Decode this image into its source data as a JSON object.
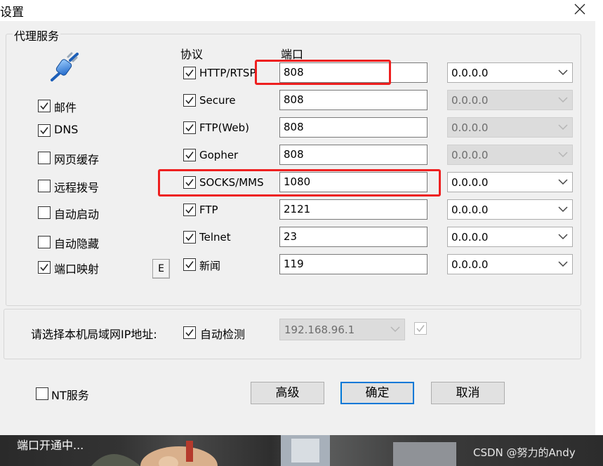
{
  "window": {
    "title": "设置"
  },
  "proxy_group": {
    "title": "代理服务",
    "services": [
      {
        "label": "邮件",
        "checked": true
      },
      {
        "label": "DNS",
        "checked": true
      },
      {
        "label": "网页缓存",
        "checked": false
      },
      {
        "label": "远程拨号",
        "checked": false
      },
      {
        "label": "自动启动",
        "checked": false
      },
      {
        "label": "自动隐藏",
        "checked": false
      },
      {
        "label": "端口映射",
        "checked": true
      }
    ],
    "port_map_button": "E",
    "protocol_header": "协议",
    "port_header": "端口",
    "protocols": [
      {
        "label": "HTTP/RTSP",
        "checked": true,
        "port": "808",
        "ip": "0.0.0.0",
        "ip_enabled": true
      },
      {
        "label": "Secure",
        "checked": true,
        "port": "808",
        "ip": "0.0.0.0",
        "ip_enabled": false
      },
      {
        "label": "FTP(Web)",
        "checked": true,
        "port": "808",
        "ip": "0.0.0.0",
        "ip_enabled": false
      },
      {
        "label": "Gopher",
        "checked": true,
        "port": "808",
        "ip": "0.0.0.0",
        "ip_enabled": false
      },
      {
        "label": "SOCKS/MMS",
        "checked": true,
        "port": "1080",
        "ip": "0.0.0.0",
        "ip_enabled": true
      },
      {
        "label": "FTP",
        "checked": true,
        "port": "2121",
        "ip": "0.0.0.0",
        "ip_enabled": true
      },
      {
        "label": "Telnet",
        "checked": true,
        "port": "23",
        "ip": "0.0.0.0",
        "ip_enabled": true
      },
      {
        "label": "新闻",
        "checked": true,
        "port": "119",
        "ip": "0.0.0.0",
        "ip_enabled": true
      }
    ]
  },
  "lan_ip": {
    "label": "请选择本机局域网IP地址:",
    "auto_detect_label": "自动检测",
    "auto_detect_checked": true,
    "ip_value": "192.168.96.1",
    "extra_checkbox_checked": true
  },
  "nt_service": {
    "label": "NT服务",
    "checked": false
  },
  "buttons": {
    "advanced": "高级",
    "ok": "确定",
    "cancel": "取消"
  },
  "footer": {
    "status": "端口开通中...",
    "watermark": "CSDN @努力的Andy"
  },
  "colors": {
    "highlight_box": "#ee1f1f",
    "focus_border": "#0078d7",
    "disabled_field": "#dcdcdc"
  },
  "icons": {
    "logo": "network-plug-icon",
    "close": "close-icon",
    "dropdown": "chevron-down-icon",
    "check": "checkmark-icon"
  }
}
